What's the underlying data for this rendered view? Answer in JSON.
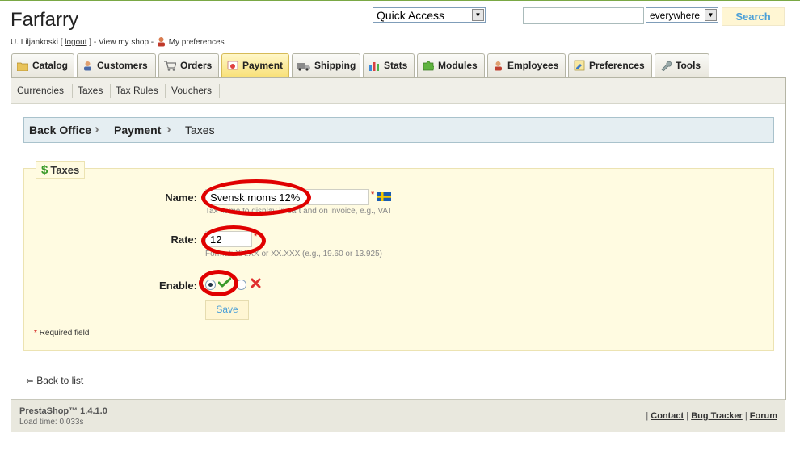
{
  "header": {
    "shop_title": "Farfarry",
    "user_name": "U. Liljankoski [",
    "logout": "logout",
    "user_tail": "] - View my shop -",
    "my_preferences": "My preferences",
    "quick_access": "Quick Access",
    "search_scope": "everywhere",
    "search_value": "",
    "search_button": "Search"
  },
  "tabs": [
    {
      "label": "Catalog",
      "icon": "folder-icon"
    },
    {
      "label": "Customers",
      "icon": "customer-icon"
    },
    {
      "label": "Orders",
      "icon": "cart-icon"
    },
    {
      "label": "Payment",
      "icon": "payment-icon",
      "active": true
    },
    {
      "label": "Shipping",
      "icon": "truck-icon"
    },
    {
      "label": "Stats",
      "icon": "stats-icon"
    },
    {
      "label": "Modules",
      "icon": "puzzle-icon"
    },
    {
      "label": "Employees",
      "icon": "employee-icon"
    },
    {
      "label": "Preferences",
      "icon": "preferences-icon"
    },
    {
      "label": "Tools",
      "icon": "wrench-icon"
    }
  ],
  "subnav": [
    "Currencies",
    "Taxes",
    "Tax Rules",
    "Vouchers"
  ],
  "breadcrumb": [
    "Back Office",
    "Payment",
    "Taxes"
  ],
  "form": {
    "legend": "Taxes",
    "name_label": "Name:",
    "name_value": "Svensk moms 12%",
    "name_hint": "Tax name to display in cart and on invoice, e.g., VAT",
    "rate_label": "Rate:",
    "rate_value": "12",
    "rate_hint": "Format: XX.XX or XX.XXX (e.g., 19.60 or 13.925)",
    "enable_label": "Enable:",
    "enabled": true,
    "save_button": "Save",
    "required_note": "Required field",
    "required_star": "*"
  },
  "back_to_list": "Back to list",
  "footer": {
    "brand": "PrestaShop™ 1.4.1.0",
    "load_time": "Load time: 0.033s",
    "links": [
      "Contact",
      "Bug Tracker",
      "Forum"
    ]
  },
  "colors": {
    "accent": "#4a9fd8",
    "annotation_red": "#e00000",
    "active_tab": "#f8df73",
    "form_bg": "#fffbe1"
  }
}
